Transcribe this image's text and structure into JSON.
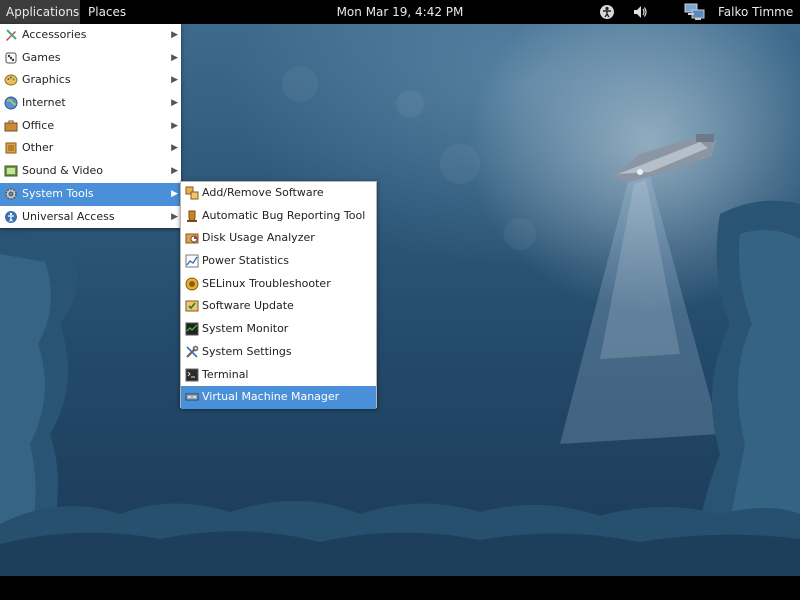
{
  "panel": {
    "applications_label": "Applications",
    "places_label": "Places",
    "clock": "Mon Mar 19,  4:42 PM",
    "user_name": "Falko Timme"
  },
  "tray_icons": [
    "accessibility-icon",
    "volume-icon",
    "network-icon"
  ],
  "applications_menu": {
    "items": [
      {
        "label": "Accessories",
        "icon": "accessories-icon",
        "has_submenu": true
      },
      {
        "label": "Games",
        "icon": "games-icon",
        "has_submenu": true
      },
      {
        "label": "Graphics",
        "icon": "graphics-icon",
        "has_submenu": true
      },
      {
        "label": "Internet",
        "icon": "internet-icon",
        "has_submenu": true
      },
      {
        "label": "Office",
        "icon": "office-icon",
        "has_submenu": true
      },
      {
        "label": "Other",
        "icon": "other-icon",
        "has_submenu": true
      },
      {
        "label": "Sound & Video",
        "icon": "sound-video-icon",
        "has_submenu": true
      },
      {
        "label": "System Tools",
        "icon": "system-tools-icon",
        "has_submenu": true,
        "selected": true
      },
      {
        "label": "Universal Access",
        "icon": "universal-access-icon",
        "has_submenu": true
      }
    ]
  },
  "system_tools_menu": {
    "items": [
      {
        "label": "Add/Remove Software",
        "icon": "package-icon"
      },
      {
        "label": "Automatic Bug Reporting Tool",
        "icon": "bug-report-icon"
      },
      {
        "label": "Disk Usage Analyzer",
        "icon": "disk-usage-icon"
      },
      {
        "label": "Power Statistics",
        "icon": "power-statistics-icon"
      },
      {
        "label": "SELinux Troubleshooter",
        "icon": "selinux-icon"
      },
      {
        "label": "Software Update",
        "icon": "software-update-icon"
      },
      {
        "label": "System Monitor",
        "icon": "system-monitor-icon"
      },
      {
        "label": "System Settings",
        "icon": "settings-tools-icon"
      },
      {
        "label": "Terminal",
        "icon": "terminal-icon"
      },
      {
        "label": "Virtual Machine Manager",
        "icon": "virtual-machine-icon",
        "selected": true
      }
    ]
  },
  "colors": {
    "panel_bg": "#000000",
    "menu_bg": "#ffffff",
    "selection": "#4a90d9",
    "wallpaper_top": "#3d6a8c",
    "wallpaper_bottom": "#1b3b57"
  }
}
